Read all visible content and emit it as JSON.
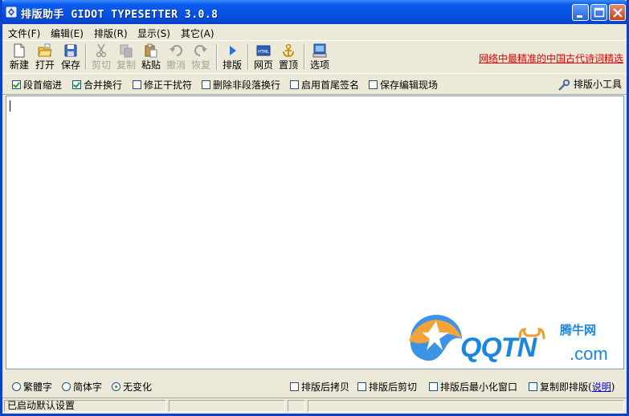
{
  "window": {
    "title": "排版助手 GIDOT TYPESETTER 3.0.8"
  },
  "menu": [
    {
      "label": "文件(F)"
    },
    {
      "label": "编辑(E)"
    },
    {
      "label": "排版(R)"
    },
    {
      "label": "显示(S)"
    },
    {
      "label": "其它(A)"
    }
  ],
  "toolbar": {
    "new": "新建",
    "open": "打开",
    "save": "保存",
    "cut": "剪切",
    "copy": "复制",
    "paste": "粘贴",
    "undo": "撤消",
    "redo": "恢复",
    "typeset": "排版",
    "webpage": "网页",
    "pin_top": "置顶",
    "options": "选项",
    "promo_link": "网络中最精准的中国古代诗词精选"
  },
  "options": {
    "indent": {
      "label": "段首缩进",
      "checked": true
    },
    "merge": {
      "label": "合并换行",
      "checked": true
    },
    "fix_interference": {
      "label": "修正干扰符",
      "checked": false
    },
    "remove_breaks": {
      "label": "删除非段落换行",
      "checked": false
    },
    "signature": {
      "label": "启用首尾签名",
      "checked": false
    },
    "save_scene": {
      "label": "保存编辑现场",
      "checked": false
    },
    "tools_button": "排版小工具"
  },
  "editor": {
    "content": ""
  },
  "watermark": {
    "top_text": "腾牛网",
    "brand": "QQTN",
    "suffix": ".com"
  },
  "bottom": {
    "conversion": [
      {
        "label": "繁體字",
        "selected": false
      },
      {
        "label": "简体字",
        "selected": false
      },
      {
        "label": "无变化",
        "selected": true
      }
    ],
    "after_copy": {
      "label": "排版后拷贝",
      "checked": false
    },
    "after_cut": {
      "label": "排版后剪切",
      "checked": false
    },
    "after_minimize": {
      "label": "排版后最小化窗口",
      "checked": false
    },
    "copy_typeset": {
      "label": "复制即排版",
      "checked": false
    },
    "help_open": "(",
    "help_link": "说明",
    "help_close": ")"
  },
  "status": {
    "message": "已启动默认设置"
  }
}
